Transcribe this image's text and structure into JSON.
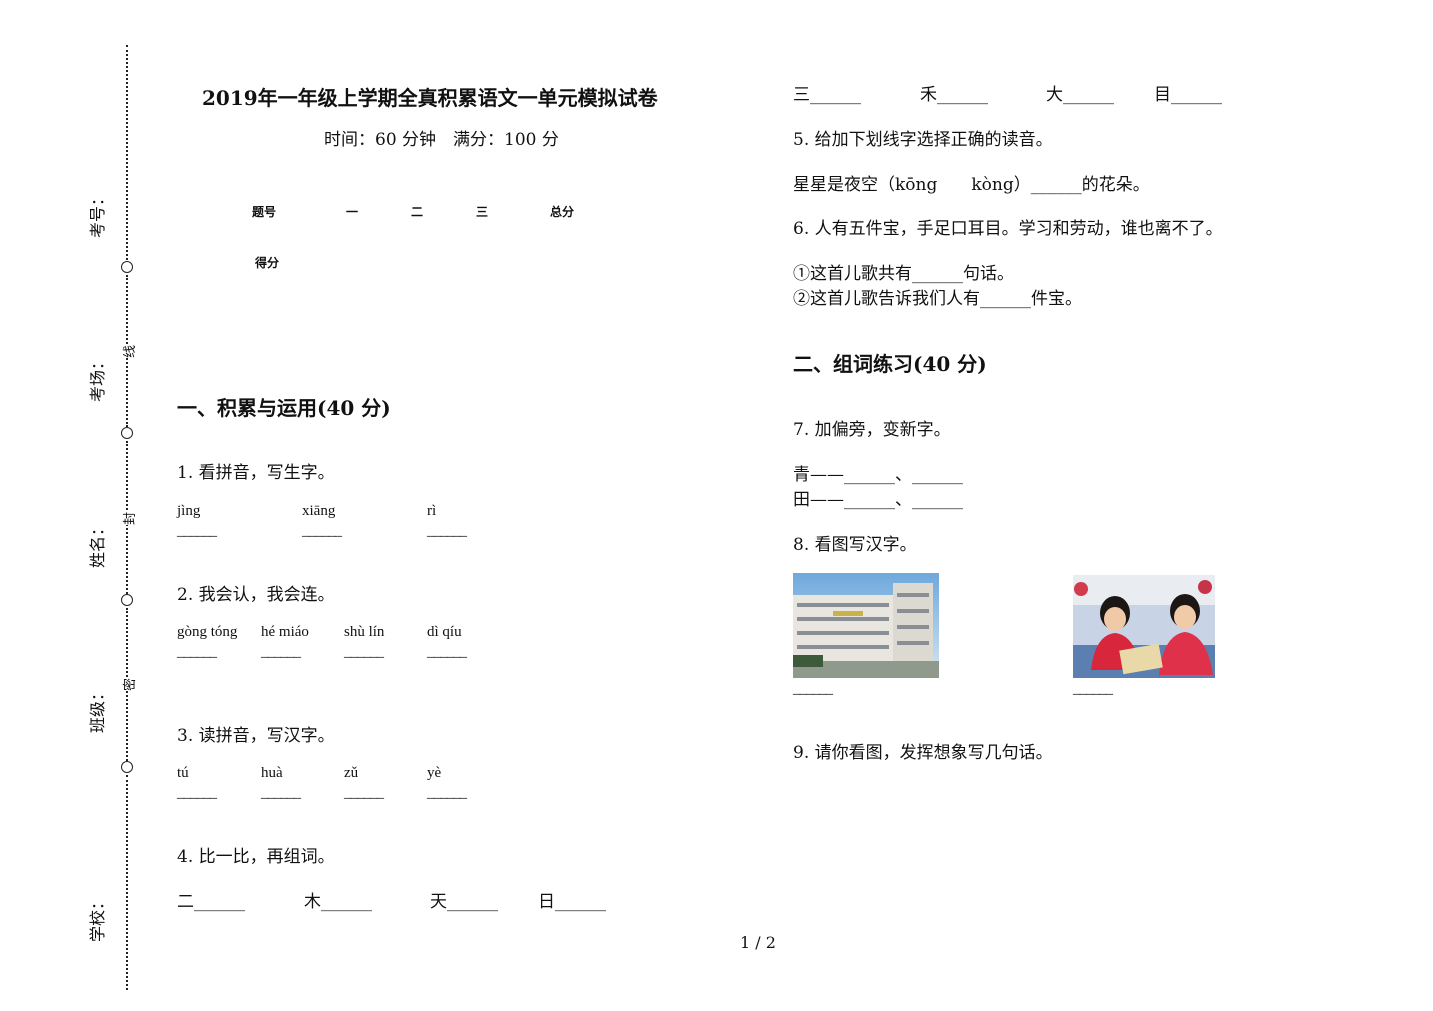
{
  "margin": {
    "labels": [
      "考号：",
      "考场：",
      "姓名：",
      "班级：",
      "学校："
    ],
    "small": [
      "线",
      "封",
      "密"
    ]
  },
  "header": {
    "title": "2019年一年级上学期全真积累语文一单元模拟试卷",
    "subtitle": "时间：60 分钟　满分：100 分"
  },
  "score_table": {
    "headers": [
      "题号",
      "一",
      "二",
      "三",
      "总分"
    ],
    "row_label": "得分"
  },
  "sections": {
    "s1": "一、积累与运用(40 分)",
    "s2": "二、组词练习(40 分)"
  },
  "q1": {
    "text": "1.  看拼音，写生字。",
    "pinyin": [
      "jìng",
      "xiāng",
      "rì"
    ],
    "blank": "______"
  },
  "q2": {
    "text": "2.  我会认，我会连。",
    "pinyin": [
      "gòng tóng",
      "hé miáo",
      "shù lín",
      "dì qíu"
    ],
    "blank": "______"
  },
  "q3": {
    "text": "3.  读拼音，写汉字。",
    "pinyin": [
      "tú",
      "huà",
      "zǔ",
      "yè"
    ],
    "blank": "______"
  },
  "q4": {
    "text": "4.  比一比，再组词。",
    "row1": [
      "二______",
      "木______",
      "天______",
      "日______"
    ],
    "row2": [
      "三______",
      "禾______",
      "大______",
      "目______"
    ]
  },
  "q5": {
    "text": "5.  给加下划线字选择正确的读音。",
    "line": "星星是夜空（kōng　　kòng）______的花朵。"
  },
  "q6": {
    "text": "6.  人有五件宝，手足口耳目。学习和劳动，谁也离不了。",
    "l1": "①这首儿歌共有______句话。",
    "l2": "②这首儿歌告诉我们人有______件宝。"
  },
  "q7": {
    "text": "7.  加偏旁，变新字。",
    "l1": "青——______、______",
    "l2": "田——______、______"
  },
  "q8": {
    "text": "8.  看图写汉字。",
    "blank": "______"
  },
  "q9": {
    "text": "9.  请你看图，发挥想象写几句话。"
  },
  "footer": {
    "page": "1 / 2"
  }
}
